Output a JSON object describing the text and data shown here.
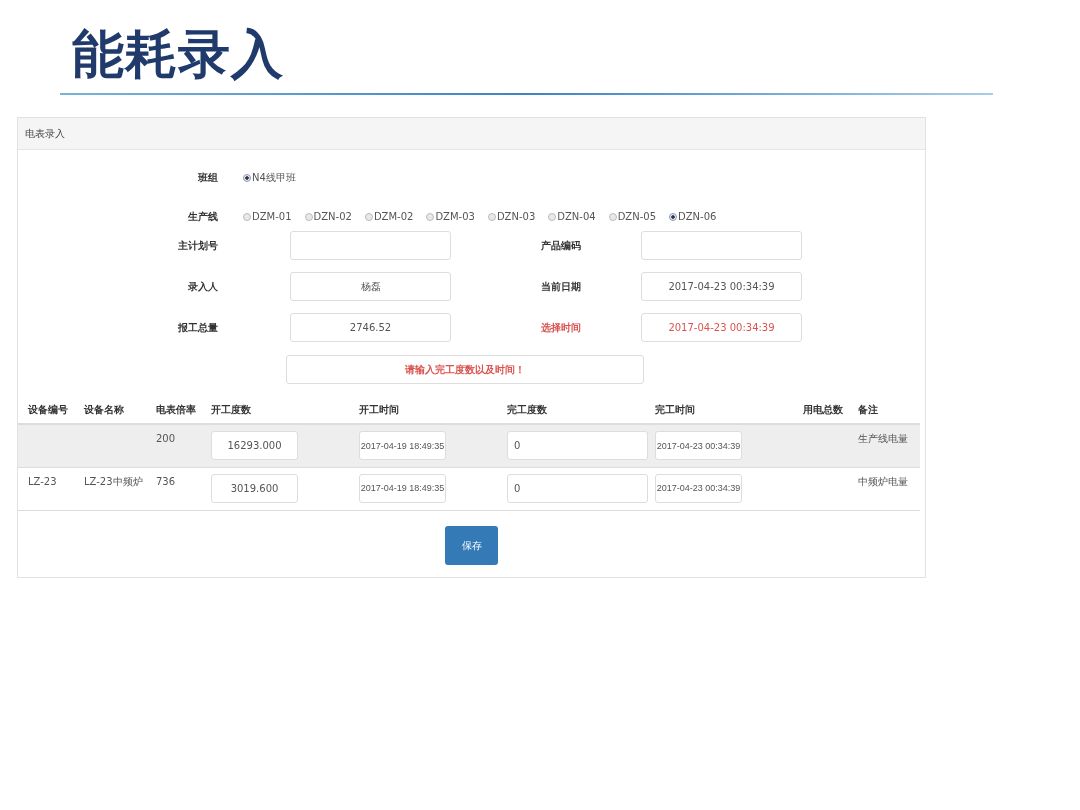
{
  "slide_title": "能耗录入",
  "panel": {
    "title": "电表录入",
    "team": {
      "label": "班组",
      "options": [
        {
          "label": "N4线甲班",
          "selected": true
        }
      ]
    },
    "line": {
      "label": "生产线",
      "options": [
        {
          "label": "DZM-01",
          "selected": false
        },
        {
          "label": "DZN-02",
          "selected": false
        },
        {
          "label": "DZM-02",
          "selected": false
        },
        {
          "label": "DZM-03",
          "selected": false
        },
        {
          "label": "DZN-03",
          "selected": false
        },
        {
          "label": "DZN-04",
          "selected": false
        },
        {
          "label": "DZN-05",
          "selected": false
        },
        {
          "label": "DZN-06",
          "selected": true
        }
      ]
    },
    "fields": [
      {
        "label": "主计划号",
        "alert": false
      },
      {
        "label": "产品编码",
        "alert": false
      },
      {
        "label": "录入人",
        "value": "杨磊",
        "alert": false
      },
      {
        "label": "当前日期",
        "value": "2017-04-23 00:34:39",
        "alert": false
      },
      {
        "label": "报工总量",
        "value": "2746.52",
        "alert": false
      },
      {
        "label": "选择时间",
        "value": "2017-04-23 00:34:39",
        "alert": true
      }
    ],
    "message": "请输入完工度数以及时间！",
    "table": {
      "columns": [
        "设备编号",
        "设备名称",
        "电表倍率",
        "开工度数",
        "开工时间",
        "完工度数",
        "完工时间",
        "用电总数",
        "备注"
      ],
      "rows": [
        {
          "highlighted": true,
          "multiplier": "200",
          "start_reading": "16293.000",
          "start_time": "2017-04-19 18:49:35",
          "end_reading": "0",
          "end_time": "2017-04-23 00:34:39",
          "note": "生产线电量"
        },
        {
          "highlighted": false,
          "device_no": "LZ-23",
          "device_name": "LZ-23中频炉",
          "multiplier": "736",
          "start_reading": "3019.600",
          "start_time": "2017-04-19 18:49:35",
          "end_reading": "0",
          "end_time": "2017-04-23 00:34:39",
          "note": "中频炉电量"
        }
      ]
    },
    "save_button": "保存"
  }
}
